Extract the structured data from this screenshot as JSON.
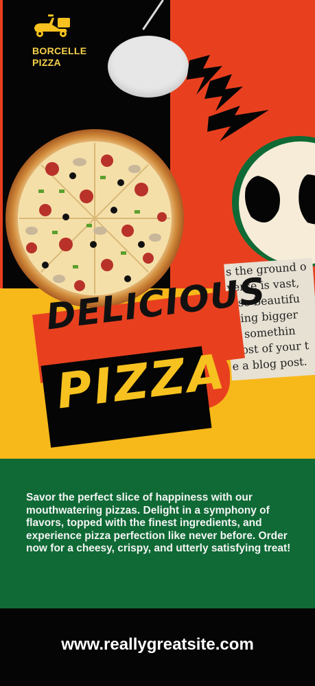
{
  "brand": {
    "line1": "BORCELLE",
    "line2": "PIZZA",
    "logo_icon": "scooter-icon"
  },
  "headline": {
    "line1": "DELICIOUS",
    "line2": "PIZZA"
  },
  "paper_text": [
    "s the ground o",
    "verse is vast,",
    "also beautifu",
    "thing bigger",
    "of somethin",
    "most of your t",
    "e a blog post.",
    "—"
  ],
  "description": "Savor the perfect slice of happiness with our mouthwatering pizzas. Delight in a symphony of flavors, topped with the finest ingredients, and experience pizza perfection like never before. Order now for a cheesy, crispy, and utterly satisfying treat!",
  "footer": {
    "url": "www.reallygreatsite.com"
  },
  "colors": {
    "red": "#e8401f",
    "yellow": "#f7b81a",
    "green": "#0f6a35",
    "black": "#050505",
    "brand_yellow": "#f7d24a"
  }
}
